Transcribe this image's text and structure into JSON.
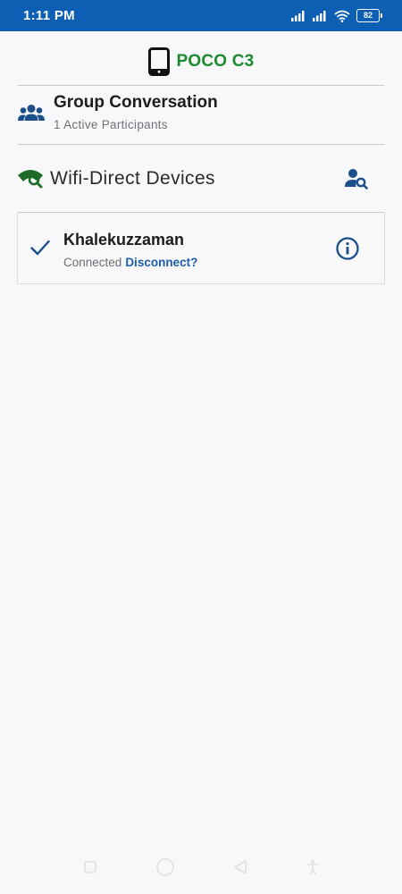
{
  "status_bar": {
    "time": "1:11 PM",
    "battery": "82",
    "icons": [
      "signal-icon",
      "signal-icon",
      "wifi-icon",
      "battery-icon"
    ]
  },
  "device_header": {
    "icon": "tablet-icon",
    "name": "POCO C3"
  },
  "group": {
    "icon": "group-icon",
    "title": "Group Conversation",
    "subtitle": "1 Active Participants"
  },
  "wifi_direct": {
    "icon": "wifi-search-icon",
    "title": "Wifi-Direct Devices",
    "action_icon": "person-search-icon"
  },
  "peers": [
    {
      "icon": "check-icon",
      "name": "Khalekuzzaman",
      "status": "Connected",
      "action": "Disconnect?",
      "info_icon": "info-icon"
    }
  ],
  "nav": {
    "icons": [
      "square-icon",
      "circle-icon",
      "back-icon",
      "accessibility-icon"
    ]
  },
  "colors": {
    "status_bar": "#0d5fb3",
    "device_name": "#1e8a2e",
    "icon_blue": "#1a4f8a",
    "wifi_green": "#1e6b2a",
    "link": "#1a5fa8"
  }
}
